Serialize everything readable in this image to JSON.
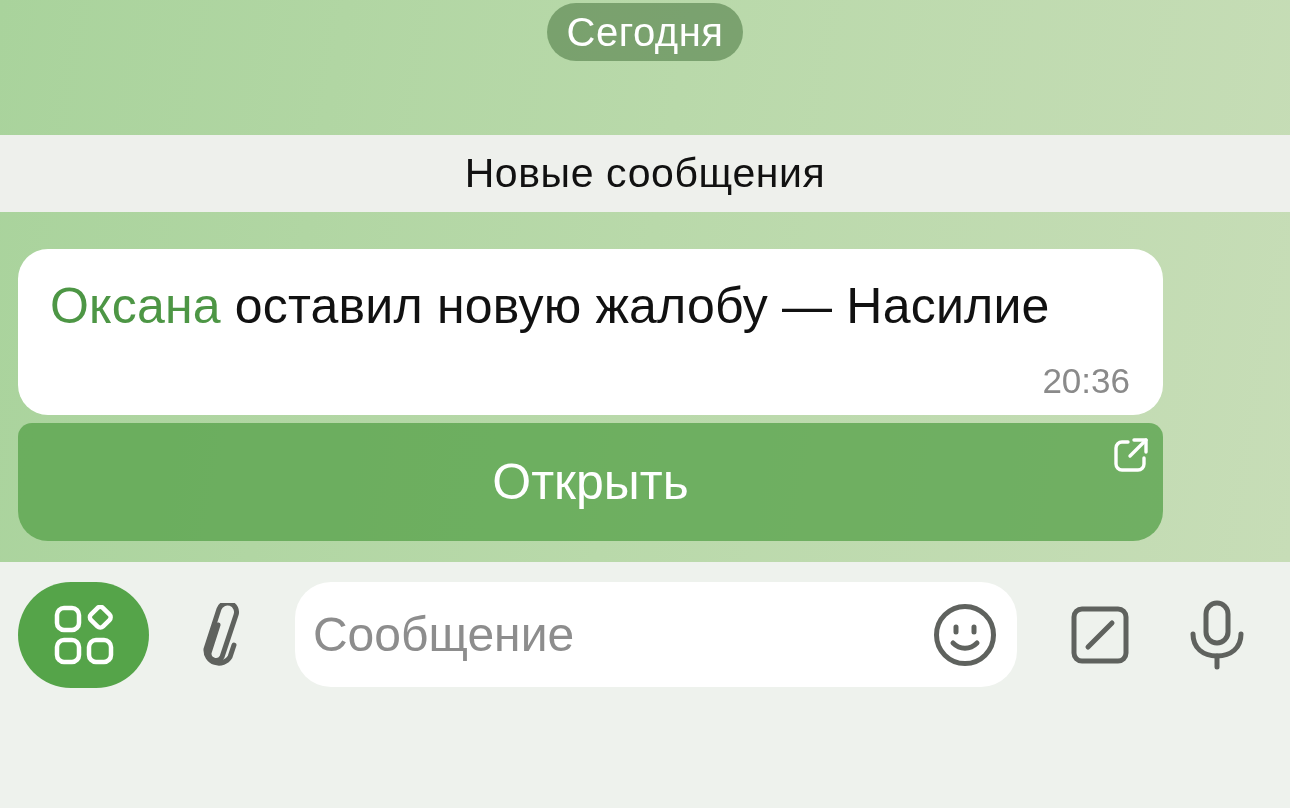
{
  "date_pill": {
    "label": "Сегодня"
  },
  "unread_divider": {
    "label": "Новые сообщения"
  },
  "message": {
    "sender": "Оксана",
    "text": "оставил новую жалобу — Насилие",
    "time": "20:36"
  },
  "inline_button": {
    "label": "Открыть"
  },
  "composer": {
    "placeholder": "Сообщение"
  }
}
